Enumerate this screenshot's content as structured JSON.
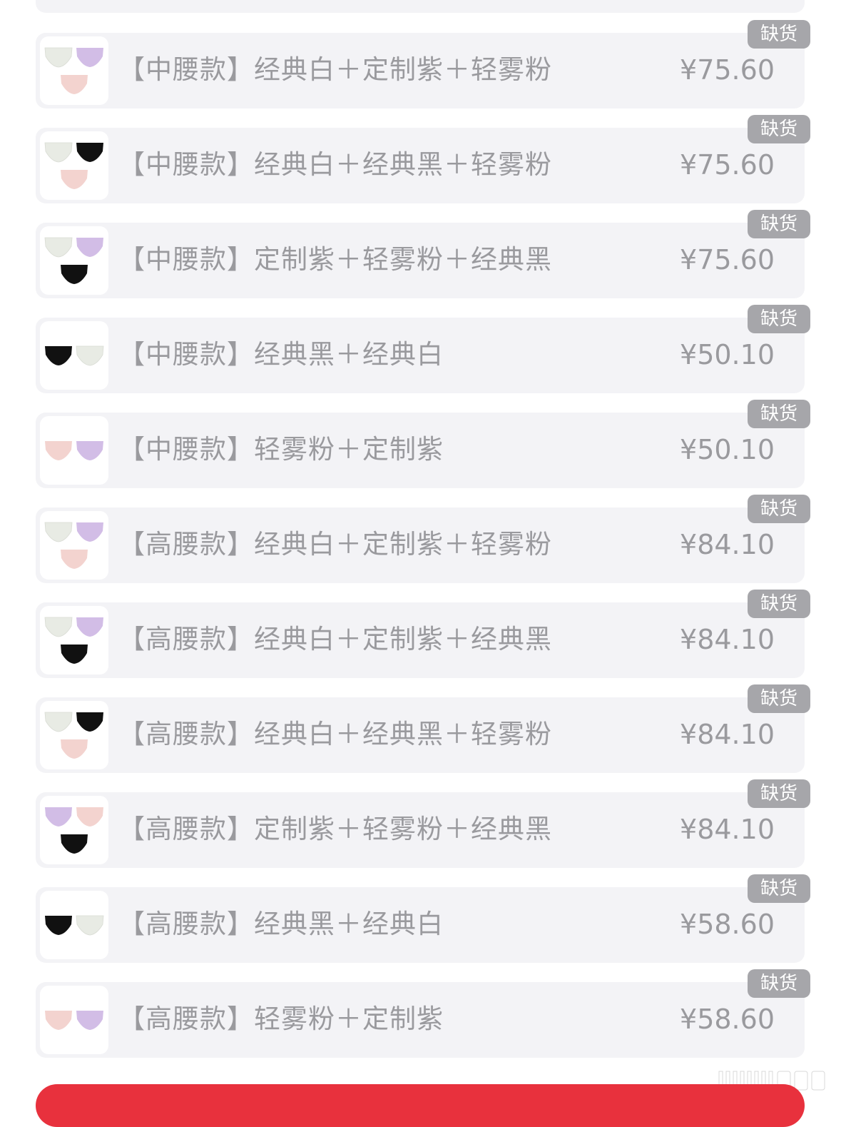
{
  "options": [
    {
      "name": "【中腰款】经典白＋定制紫＋轻雾粉",
      "price": "¥75.60",
      "badge": "缺货",
      "swatches": [
        "white",
        "purple",
        "pink"
      ]
    },
    {
      "name": "【中腰款】经典白＋经典黑＋轻雾粉",
      "price": "¥75.60",
      "badge": "缺货",
      "swatches": [
        "white",
        "black",
        "pink"
      ]
    },
    {
      "name": "【中腰款】定制紫＋轻雾粉＋经典黑",
      "price": "¥75.60",
      "badge": "缺货",
      "swatches": [
        "white",
        "purple",
        "black"
      ]
    },
    {
      "name": "【中腰款】经典黑＋经典白",
      "price": "¥50.10",
      "badge": "缺货",
      "swatches": [
        "black",
        "white"
      ]
    },
    {
      "name": "【中腰款】轻雾粉＋定制紫",
      "price": "¥50.10",
      "badge": "缺货",
      "swatches": [
        "pink",
        "purple"
      ]
    },
    {
      "name": "【高腰款】经典白＋定制紫＋轻雾粉",
      "price": "¥84.10",
      "badge": "缺货",
      "swatches": [
        "white",
        "purple",
        "pink"
      ]
    },
    {
      "name": "【高腰款】经典白＋定制紫＋经典黑",
      "price": "¥84.10",
      "badge": "缺货",
      "swatches": [
        "white",
        "purple",
        "black"
      ]
    },
    {
      "name": "【高腰款】经典白＋经典黑＋轻雾粉",
      "price": "¥84.10",
      "badge": "缺货",
      "swatches": [
        "white",
        "black",
        "pink"
      ]
    },
    {
      "name": "【高腰款】定制紫＋轻雾粉＋经典黑",
      "price": "¥84.10",
      "badge": "缺货",
      "swatches": [
        "purple",
        "pink",
        "black"
      ]
    },
    {
      "name": "【高腰款】经典黑＋经典白",
      "price": "¥58.60",
      "badge": "缺货",
      "swatches": [
        "black",
        "white"
      ]
    },
    {
      "name": "【高腰款】轻雾粉＋定制紫",
      "price": "¥58.60",
      "badge": "缺货",
      "swatches": [
        "pink",
        "purple"
      ]
    }
  ],
  "colors": {
    "white": "#e8ebe4",
    "black": "#111111",
    "pink": "#f3d3cf",
    "purple": "#d2bde6",
    "badge": "#a6a6aa",
    "buy_button": "#e8313d",
    "card_bg": "#f3f3f6"
  }
}
